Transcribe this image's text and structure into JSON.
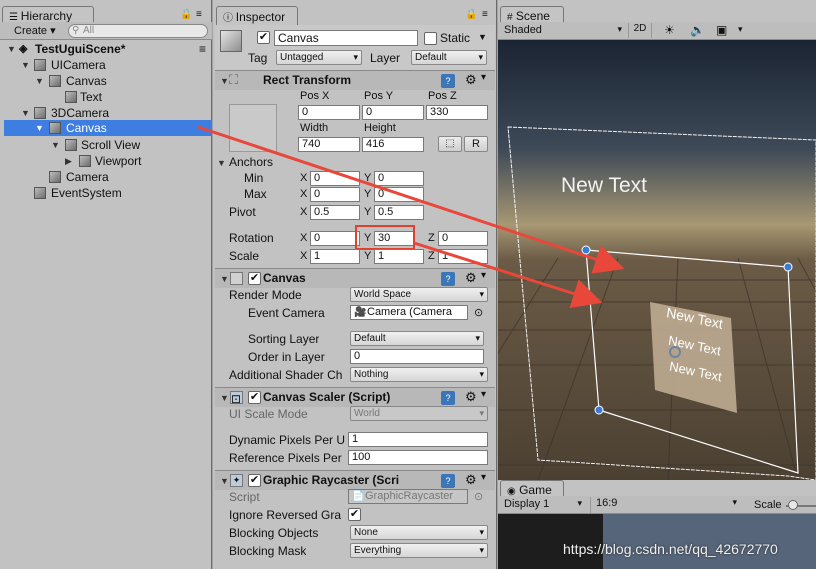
{
  "hierarchy": {
    "tab": "Hierarchy",
    "create": "Create",
    "search_placeholder": "All",
    "scene": "TestUguiScene*",
    "items": [
      "UICamera",
      "Canvas",
      "Text",
      "3DCamera",
      "Canvas",
      "Scroll View",
      "Viewport",
      "Camera",
      "EventSystem"
    ]
  },
  "inspector": {
    "tab": "Inspector",
    "object_name": "Canvas",
    "static_label": "Static",
    "tag_label": "Tag",
    "tag_value": "Untagged",
    "layer_label": "Layer",
    "layer_value": "Default",
    "rect_transform": {
      "title": "Rect Transform",
      "pos_x_label": "Pos X",
      "pos_y_label": "Pos Y",
      "pos_z_label": "Pos Z",
      "pos_x": "0",
      "pos_y": "0",
      "pos_z": "330",
      "width_label": "Width",
      "height_label": "Height",
      "width": "740",
      "height": "416",
      "r_button": "R",
      "anchors": "Anchors",
      "min": "Min",
      "max": "Max",
      "min_x": "0",
      "min_y": "0",
      "max_x": "0",
      "max_y": "0",
      "pivot": "Pivot",
      "pivot_x": "0.5",
      "pivot_y": "0.5",
      "rotation": "Rotation",
      "rot_x": "0",
      "rot_y": "30",
      "rot_z": "0",
      "scale": "Scale",
      "scale_x": "1",
      "scale_y": "1",
      "scale_z": "1",
      "x": "X",
      "y": "Y",
      "z": "Z"
    },
    "canvas": {
      "title": "Canvas",
      "render_mode_label": "Render Mode",
      "render_mode": "World Space",
      "event_camera_label": "Event Camera",
      "event_camera": "Camera (Camera",
      "sorting_layer_label": "Sorting Layer",
      "sorting_layer": "Default",
      "order_label": "Order in Layer",
      "order": "0",
      "shader_label": "Additional Shader Ch",
      "shader": "Nothing"
    },
    "canvas_scaler": {
      "title": "Canvas Scaler (Script)",
      "ui_scale_label": "UI Scale Mode",
      "ui_scale": "World",
      "dynamic_label": "Dynamic Pixels Per U",
      "dynamic": "1",
      "reference_label": "Reference Pixels Per",
      "reference": "100"
    },
    "raycaster": {
      "title": "Graphic Raycaster (Scri",
      "script_label": "Script",
      "script": "GraphicRaycaster",
      "ignore_label": "Ignore Reversed Gra",
      "blocking_objects_label": "Blocking Objects",
      "blocking_objects": "None",
      "blocking_mask_label": "Blocking Mask",
      "blocking_mask": "Everything"
    }
  },
  "scene": {
    "tab": "Scene",
    "shading": "Shaded",
    "mode_2d": "2D",
    "text_large": "New Text",
    "text_small": [
      "New Text",
      "New Text",
      "New Text"
    ]
  },
  "game": {
    "tab": "Game",
    "display": "Display 1",
    "aspect": "16:9",
    "scale": "Scale"
  },
  "watermark": "https://blog.csdn.net/qq_42672770",
  "colors": {
    "selection": "#3e7ee0",
    "arrow": "#e8473a",
    "highlight_box": "#e04030"
  }
}
